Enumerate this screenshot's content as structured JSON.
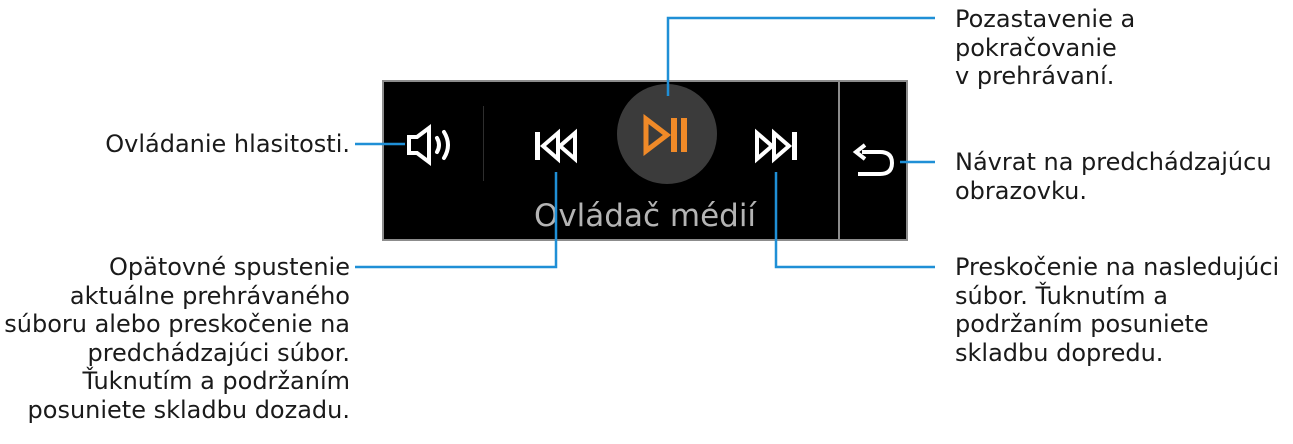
{
  "device": {
    "title": "Ovládač médií",
    "icons": {
      "volume": "volume-icon",
      "previous": "previous-track-icon",
      "play_pause": "play-pause-icon",
      "next": "next-track-icon",
      "back": "back-arrow-icon"
    },
    "colors": {
      "background": "#000000",
      "border": "#8c8c8c",
      "play_circle": "#3b3b3b",
      "accent": "#f08a28",
      "icon": "#ffffff",
      "title": "#b4b4b4",
      "callout_line": "#1f8fd6"
    }
  },
  "callouts": {
    "play_pause": "Pozastavenie a pokračovanie\nv prehrávaní.",
    "volume": "Ovládanie hlasitosti.",
    "back": "Návrat na predchádzajúcu\nobrazovku.",
    "previous": "Opätovné spustenie\naktuálne prehrávaného\nsúboru alebo preskočenie na\npredchádzajúci súbor.\nŤuknutím a podržaním\nposuniete skladbu dozadu.",
    "next": "Preskočenie na nasledujúci\nsúbor. Ťuknutím a\npodržaním posuniete\nskladbu dopredu."
  }
}
